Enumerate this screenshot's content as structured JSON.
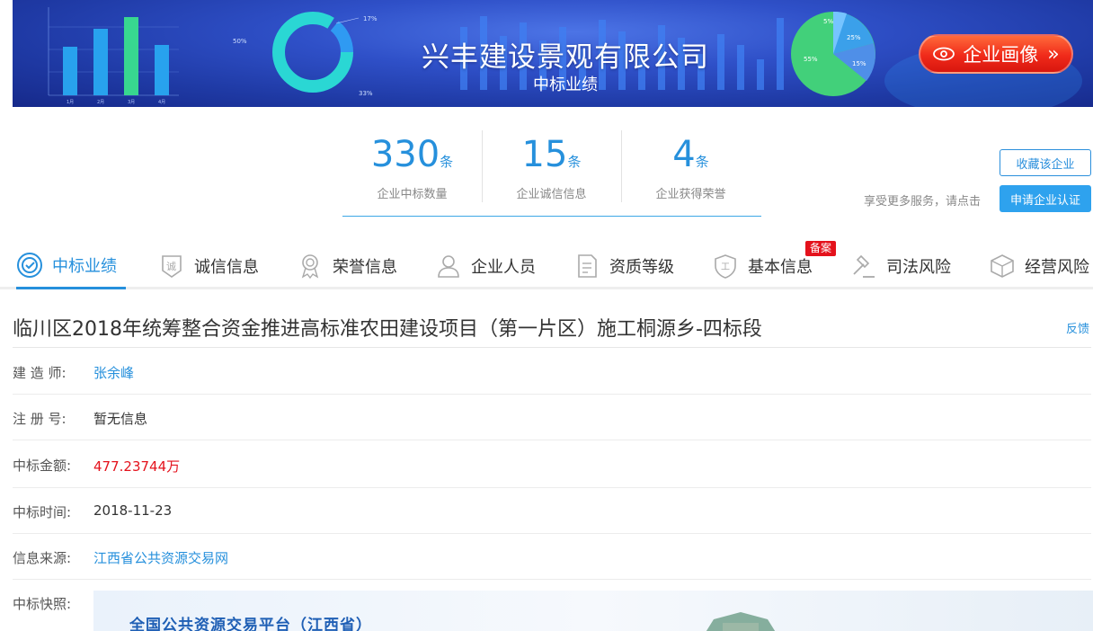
{
  "banner": {
    "company_name": "兴丰建设景观有限公司",
    "subtitle": "中标业绩",
    "portrait_button": "企业画像",
    "donut_labels": [
      "17%",
      "50%",
      "33%"
    ],
    "pie_labels": [
      "5%",
      "25%",
      "15%",
      "55%"
    ],
    "bar_labels": [
      "1月",
      "2月",
      "3月",
      "4月"
    ]
  },
  "stats": [
    {
      "value": "330",
      "unit": "条",
      "label": "企业中标数量"
    },
    {
      "value": "15",
      "unit": "条",
      "label": "企业诚信信息"
    },
    {
      "value": "4",
      "unit": "条",
      "label": "企业获得荣誉"
    }
  ],
  "actions": {
    "favorite": "收藏该企业",
    "more_service": "享受更多服务，请点击",
    "certify": "申请企业认证"
  },
  "tabs": [
    {
      "label": "中标业绩",
      "icon": "target-icon"
    },
    {
      "label": "诚信信息",
      "icon": "integrity-icon"
    },
    {
      "label": "荣誉信息",
      "icon": "medal-icon"
    },
    {
      "label": "企业人员",
      "icon": "person-icon"
    },
    {
      "label": "资质等级",
      "icon": "document-icon"
    },
    {
      "label": "基本信息",
      "icon": "shield-icon"
    },
    {
      "label": "司法风险",
      "icon": "gavel-icon"
    },
    {
      "label": "经营风险",
      "icon": "cube-icon"
    }
  ],
  "tab_badge": "备案",
  "detail": {
    "title": "临川区2018年统筹整合资金推进高标准农田建设项目（第一片区）施工桐源乡-四标段",
    "feedback": "反馈",
    "rows": [
      {
        "key": "建 造 师:",
        "value": "张余峰"
      },
      {
        "key": "注 册 号:",
        "value": "暂无信息"
      },
      {
        "key": "中标金额:",
        "value": "477.23744万"
      },
      {
        "key": "中标时间:",
        "value": "2018-11-23"
      },
      {
        "key": "信息来源:",
        "value": "江西省公共资源交易网"
      }
    ],
    "snapshot_label": "中标快照:",
    "snapshot_title": "全国公共资源交易平台（江西省）"
  },
  "colors": {
    "accent": "#2690dc",
    "money": "#e4121c",
    "portrait_button": "#f02a1a"
  }
}
